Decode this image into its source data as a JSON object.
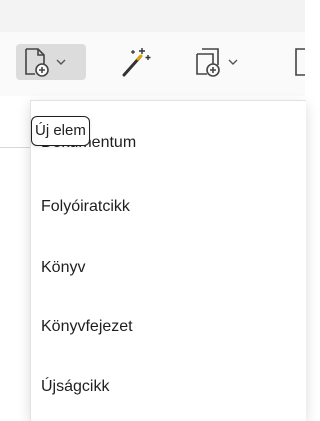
{
  "toolbar": {
    "buttons": [
      {
        "icon": "new-document-icon",
        "has_dropdown": true,
        "state": "pressed"
      },
      {
        "icon": "magic-wand-icon",
        "has_dropdown": false
      },
      {
        "icon": "copy-add-icon",
        "has_dropdown": true
      },
      {
        "icon": "document-icon",
        "has_dropdown": false
      }
    ]
  },
  "menu": {
    "items": [
      {
        "label": "Dokumentum"
      },
      {
        "label": "Folyóiratcikk"
      },
      {
        "label": "Könyv"
      },
      {
        "label": "Könyvfejezet"
      },
      {
        "label": "Újságcikk"
      }
    ]
  },
  "tooltip": {
    "text": "Új elem"
  },
  "colors": {
    "accent_icon": "#444444",
    "wand_sparkle": "#e0a200",
    "pressed_bg": "#dcdcdc",
    "toolbar_bg": "#fafafa",
    "menu_bg": "#ffffff"
  }
}
